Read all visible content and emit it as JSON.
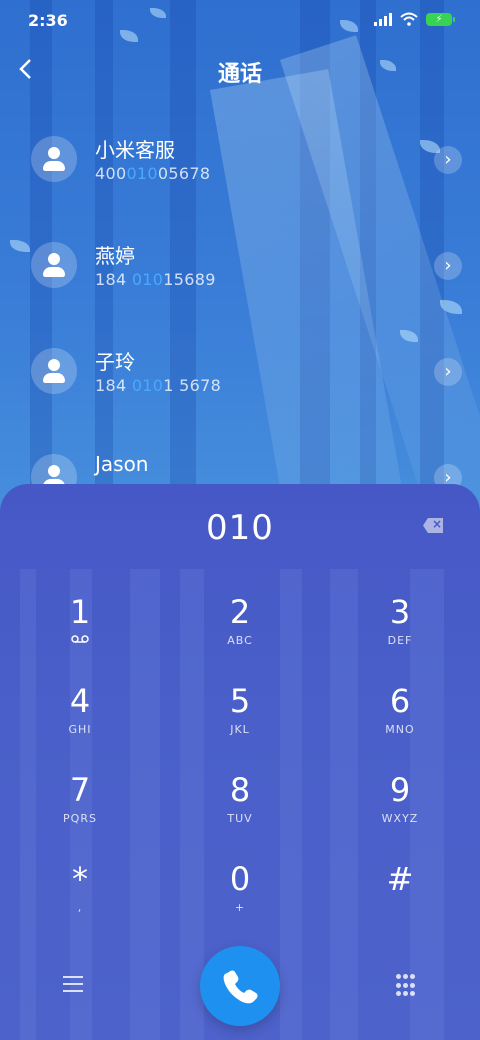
{
  "status_bar": {
    "time": "2:36",
    "icons": [
      "signal-icon",
      "wifi-icon",
      "battery-charging-icon"
    ]
  },
  "header": {
    "title": "通话",
    "back_icon": "back-arrow-icon"
  },
  "contacts": [
    {
      "name": "小米客服",
      "num_pre": "400",
      "num_hl": "010",
      "num_post": "05678"
    },
    {
      "name": "燕婷",
      "num_pre": "184 ",
      "num_hl": "010",
      "num_post": "15689"
    },
    {
      "name": "子玲",
      "num_pre": "184 ",
      "num_hl": "010",
      "num_post": "1 5678"
    },
    {
      "name": "Jason",
      "num_pre": "",
      "num_hl": "",
      "num_post": ""
    }
  ],
  "dialpad": {
    "input": "010",
    "keys": [
      {
        "digit": "1",
        "letters": "⌂"
      },
      {
        "digit": "2",
        "letters": "ABC"
      },
      {
        "digit": "3",
        "letters": "DEF"
      },
      {
        "digit": "4",
        "letters": "GHI"
      },
      {
        "digit": "5",
        "letters": "JKL"
      },
      {
        "digit": "6",
        "letters": "MNO"
      },
      {
        "digit": "7",
        "letters": "PQRS"
      },
      {
        "digit": "8",
        "letters": "TUV"
      },
      {
        "digit": "9",
        "letters": "WXYZ"
      },
      {
        "digit": "*",
        "letters": ","
      },
      {
        "digit": "0",
        "letters": "+"
      },
      {
        "digit": "#",
        "letters": ""
      }
    ]
  },
  "colors": {
    "accent": "#1e90f0",
    "highlight": "#4aa8ff",
    "panel": "#4658c6"
  }
}
